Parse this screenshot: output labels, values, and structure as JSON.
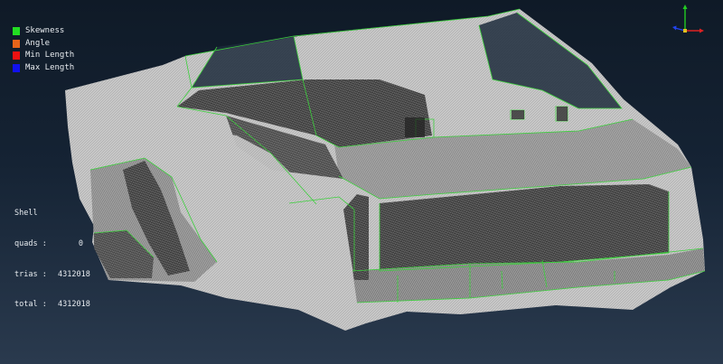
{
  "legend": {
    "items": [
      {
        "label": "Skewness",
        "color": "#22dd22"
      },
      {
        "label": "Angle",
        "color": "#e8641a"
      },
      {
        "label": "Min Length",
        "color": "#ee1111"
      },
      {
        "label": "Max Length",
        "color": "#1111ee"
      }
    ]
  },
  "stats": {
    "title": "Shell",
    "rows": [
      {
        "label": "quads :",
        "value": "0"
      },
      {
        "label": "trias :",
        "value": "4312018"
      },
      {
        "label": "total :",
        "value": "4312018"
      }
    ]
  },
  "colors": {
    "mesh": "#c4c4c4",
    "mesh_dense": "#4a4a4a",
    "feature_edges": "#3ccf3c",
    "background_top": "#0f1a27",
    "background_bottom": "#2a3a4e"
  },
  "triad_icon": "axis-triad-icon"
}
